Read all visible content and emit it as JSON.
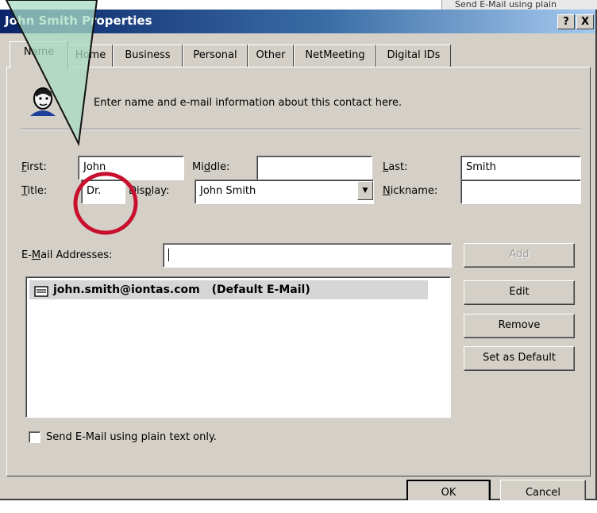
{
  "background": {
    "snippet_text": "Send E-Mail using plain"
  },
  "window": {
    "title": "John Smith Properties",
    "help_button": "?",
    "close_button": "X"
  },
  "tabs": [
    {
      "label": "Name",
      "active": true
    },
    {
      "label": "Home",
      "active": false
    },
    {
      "label": "Business",
      "active": false
    },
    {
      "label": "Personal",
      "active": false
    },
    {
      "label": "Other",
      "active": false
    },
    {
      "label": "NetMeeting",
      "active": false
    },
    {
      "label": "Digital IDs",
      "active": false
    }
  ],
  "header": {
    "icon": "contact-card-icon",
    "text": "Enter name and e-mail information about this contact here."
  },
  "name_fields": {
    "first_label": "First:",
    "first_value": "John",
    "middle_label": "Middle:",
    "middle_value": "",
    "last_label": "Last:",
    "last_value": "Smith",
    "title_label": "Title:",
    "title_value": "Dr.",
    "display_label": "Display:",
    "display_value": "John Smith",
    "nickname_label": "Nickname:",
    "nickname_value": ""
  },
  "email": {
    "label": "E-Mail Addresses:",
    "input_value": "",
    "add_button": "Add",
    "entries": [
      {
        "address": "john.smith@iontas.com",
        "tag": "(Default E-Mail)",
        "icon": "envelope-icon"
      }
    ],
    "edit_button": "Edit",
    "remove_button": "Remove",
    "set_default_button": "Set as Default"
  },
  "plain_text_option": {
    "label": "Send E-Mail using plain text only.",
    "checked": false
  },
  "footer": {
    "ok_button": "OK",
    "cancel_button": "Cancel"
  },
  "colors": {
    "annotation_circle": "#c8102e",
    "annotation_pointer_fill": "#a8dcc4",
    "title_bar": "#0a246a"
  }
}
